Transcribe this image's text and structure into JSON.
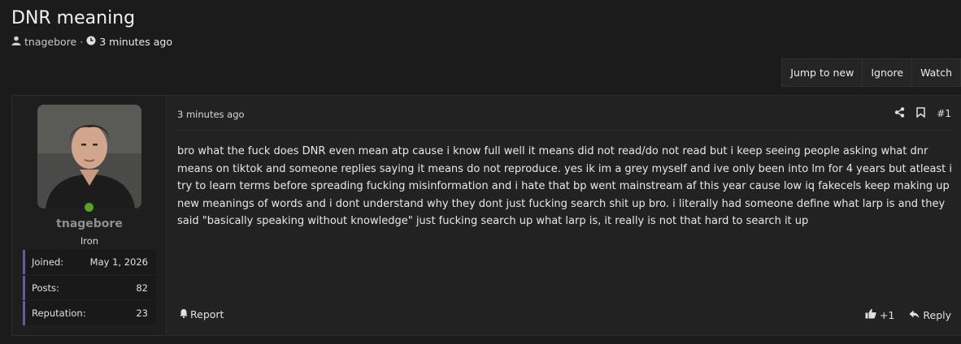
{
  "thread": {
    "title": "DNR meaning",
    "author": "tnagebore",
    "separator": "·",
    "time": "3 minutes ago"
  },
  "actions": {
    "jump_to_new": "Jump to new",
    "ignore": "Ignore",
    "watch": "Watch"
  },
  "post": {
    "date": "3 minutes ago",
    "number": "#1",
    "body": "bro what the fuck does DNR even mean atp cause i know full well it means did not read/do not read but i keep seeing people asking what dnr means on tiktok and someone replies saying it means do not reproduce. yes ik im a grey myself and ive only been into lm for 4 years but atleast i try to learn terms before spreading fucking misinformation and i hate that bp went mainstream af this year cause low iq fakecels keep making up new meanings of words and i dont understand why they dont just fucking search shit up bro. i literally had someone define what larp is and they said \"basically speaking without knowledge\" just fucking search up what larp is, it really is not that hard to search it up",
    "report_label": "Report",
    "reaction_count": "+1",
    "reply_label": "Reply"
  },
  "user": {
    "name": "tnagebore",
    "title": "Iron",
    "stats": [
      {
        "label": "Joined:",
        "value": "May 1, 2026"
      },
      {
        "label": "Posts:",
        "value": "82"
      },
      {
        "label": "Reputation:",
        "value": "23"
      }
    ]
  },
  "colors": {
    "background": "#1b1b1b",
    "panel": "#222222",
    "stat_accent": "#5c5ea6",
    "online": "#5aa02c"
  }
}
